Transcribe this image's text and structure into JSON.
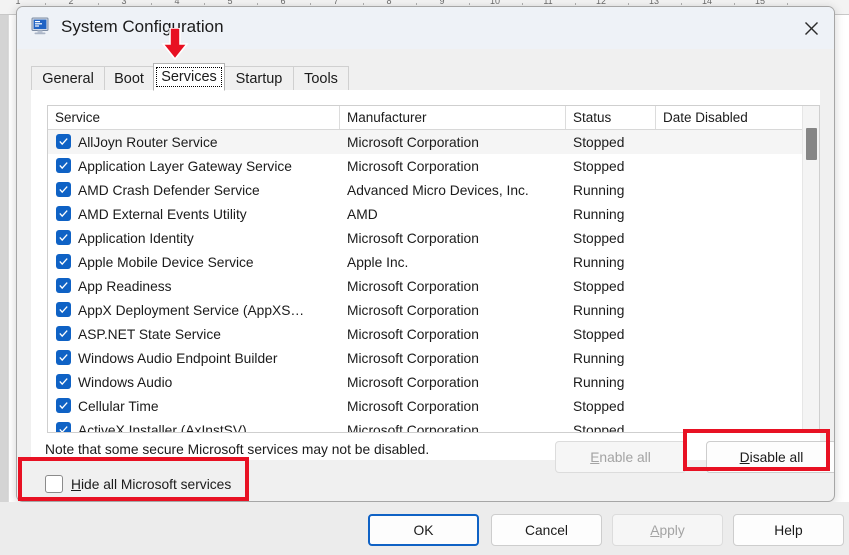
{
  "window": {
    "title": "System Configuration",
    "icon": "system-configuration-icon",
    "close_label": "✕"
  },
  "ruler": {
    "numbers": [
      "1",
      "2",
      "3",
      "4",
      "5",
      "6",
      "7",
      "8",
      "9",
      "10",
      "11",
      "12",
      "13",
      "14",
      "15"
    ]
  },
  "tabs": [
    {
      "label": "General",
      "selected": false
    },
    {
      "label": "Boot",
      "selected": false
    },
    {
      "label": "Services",
      "selected": true
    },
    {
      "label": "Startup",
      "selected": false
    },
    {
      "label": "Tools",
      "selected": false
    }
  ],
  "table": {
    "columns": [
      "Service",
      "Manufacturer",
      "Status",
      "Date Disabled"
    ],
    "rows": [
      {
        "checked": true,
        "service": "AllJoyn Router Service",
        "manufacturer": "Microsoft Corporation",
        "status": "Stopped",
        "date_disabled": ""
      },
      {
        "checked": true,
        "service": "Application Layer Gateway Service",
        "manufacturer": "Microsoft Corporation",
        "status": "Stopped",
        "date_disabled": ""
      },
      {
        "checked": true,
        "service": "AMD Crash Defender Service",
        "manufacturer": "Advanced Micro Devices, Inc.",
        "status": "Running",
        "date_disabled": ""
      },
      {
        "checked": true,
        "service": "AMD External Events Utility",
        "manufacturer": "AMD",
        "status": "Running",
        "date_disabled": ""
      },
      {
        "checked": true,
        "service": "Application Identity",
        "manufacturer": "Microsoft Corporation",
        "status": "Stopped",
        "date_disabled": ""
      },
      {
        "checked": true,
        "service": "Apple Mobile Device Service",
        "manufacturer": "Apple Inc.",
        "status": "Running",
        "date_disabled": ""
      },
      {
        "checked": true,
        "service": "App Readiness",
        "manufacturer": "Microsoft Corporation",
        "status": "Stopped",
        "date_disabled": ""
      },
      {
        "checked": true,
        "service": "AppX Deployment Service (AppXS…",
        "manufacturer": "Microsoft Corporation",
        "status": "Running",
        "date_disabled": ""
      },
      {
        "checked": true,
        "service": "ASP.NET State Service",
        "manufacturer": "Microsoft Corporation",
        "status": "Stopped",
        "date_disabled": ""
      },
      {
        "checked": true,
        "service": "Windows Audio Endpoint Builder",
        "manufacturer": "Microsoft Corporation",
        "status": "Running",
        "date_disabled": ""
      },
      {
        "checked": true,
        "service": "Windows Audio",
        "manufacturer": "Microsoft Corporation",
        "status": "Running",
        "date_disabled": ""
      },
      {
        "checked": true,
        "service": "Cellular Time",
        "manufacturer": "Microsoft Corporation",
        "status": "Stopped",
        "date_disabled": ""
      },
      {
        "checked": true,
        "service": "ActiveX Installer (AxInstSV)",
        "manufacturer": "Microsoft Corporation",
        "status": "Stopped",
        "date_disabled": ""
      }
    ]
  },
  "note": "Note that some secure Microsoft services may not be disabled.",
  "hide_all": {
    "label_prefix": "H",
    "label_rest": "ide all Microsoft services",
    "checked": false
  },
  "buttons": {
    "enable_all": {
      "label_prefix": "E",
      "label_rest": "nable all",
      "disabled": true
    },
    "disable_all": {
      "label_prefix": "D",
      "label_rest": "isable all",
      "disabled": false
    },
    "ok": "OK",
    "cancel": "Cancel",
    "apply_prefix": "A",
    "apply_rest": "pply",
    "help": "Help"
  },
  "colors": {
    "annotation_red": "#e81123",
    "checkbox_blue": "#0f62c5",
    "default_button_border": "#0f62c5"
  }
}
